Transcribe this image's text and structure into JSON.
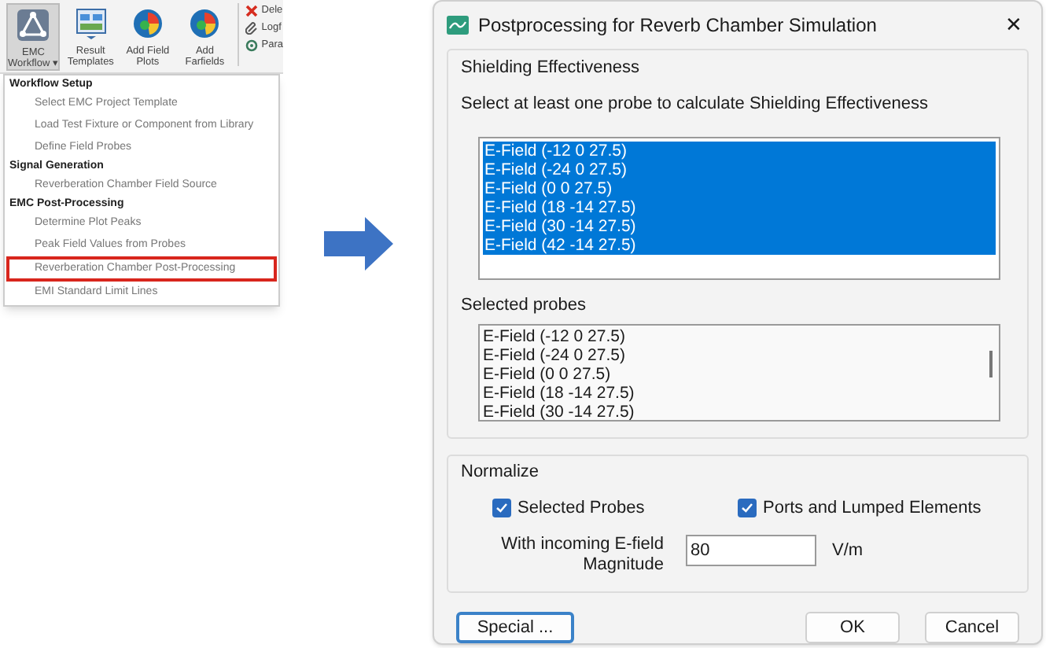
{
  "ribbon": {
    "buttons": [
      {
        "label": "EMC Workflow ▾",
        "kind": "workflow",
        "pressed": true
      },
      {
        "label": "Result Templates",
        "kind": "templates",
        "pressed": false
      },
      {
        "label": "Add Field Plots",
        "kind": "globe",
        "pressed": false
      },
      {
        "label": "Add Farfields",
        "kind": "globe",
        "pressed": false
      }
    ],
    "side_items": [
      {
        "label": "Dele",
        "kind": "delete"
      },
      {
        "label": "Logf",
        "kind": "log"
      },
      {
        "label": "Para",
        "kind": "params"
      }
    ]
  },
  "menu": {
    "sections": [
      {
        "title": "Workflow Setup",
        "items": [
          {
            "label": "Select EMC Project Template",
            "highlighted": false
          },
          {
            "label": "Load Test Fixture or Component from Library",
            "highlighted": false
          },
          {
            "label": "Define Field Probes",
            "highlighted": false
          }
        ]
      },
      {
        "title": "Signal Generation",
        "items": [
          {
            "label": "Reverberation Chamber Field Source",
            "highlighted": false
          }
        ]
      },
      {
        "title": "EMC Post-Processing",
        "items": [
          {
            "label": "Determine Plot Peaks",
            "highlighted": false
          },
          {
            "label": "Peak Field Values from Probes",
            "highlighted": false
          },
          {
            "label": "Reverberation Chamber Post-Processing",
            "highlighted": true
          },
          {
            "label": "EMI Standard Limit Lines",
            "highlighted": false
          }
        ]
      }
    ]
  },
  "dialog": {
    "title": "Postprocessing for Reverb Chamber Simulation",
    "close": "✕",
    "shielding": {
      "title": "Shielding Effectiveness",
      "instruction": "Select at least one probe to calculate Shielding Effectiveness",
      "probes": [
        {
          "label": "E-Field (-12 0 27.5)",
          "selected": true
        },
        {
          "label": "E-Field (-24 0 27.5)",
          "selected": true
        },
        {
          "label": "E-Field (0 0 27.5)",
          "selected": true
        },
        {
          "label": "E-Field (18 -14 27.5)",
          "selected": true
        },
        {
          "label": "E-Field (30 -14 27.5)",
          "selected": true
        },
        {
          "label": "E-Field (42 -14 27.5)",
          "selected": true
        }
      ],
      "selected_label": "Selected probes",
      "selected_probes": [
        "E-Field (-12 0 27.5)",
        "E-Field (-24 0 27.5)",
        "E-Field (0 0 27.5)",
        "E-Field (18 -14 27.5)",
        "E-Field (30 -14 27.5)"
      ]
    },
    "normalize": {
      "title": "Normalize",
      "checkboxes": [
        {
          "label": "Selected Probes",
          "checked": true
        },
        {
          "label": "Ports and Lumped Elements",
          "checked": true
        }
      ],
      "magnitude_label": "With incoming E-field Magnitude",
      "magnitude_value": "80",
      "unit": "V/m"
    },
    "buttons": [
      {
        "label": "Special ...",
        "focused": true
      },
      {
        "label": "OK",
        "focused": false
      },
      {
        "label": "Cancel",
        "focused": false
      }
    ]
  }
}
